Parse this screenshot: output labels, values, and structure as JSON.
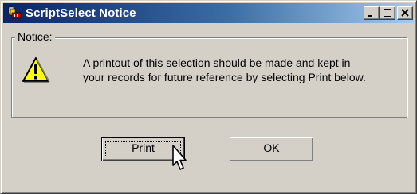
{
  "window": {
    "title": "ScriptSelect Notice"
  },
  "titlebar_buttons": {
    "minimize": "minimize-icon",
    "maximize": "maximize-icon",
    "close": "close-icon"
  },
  "notice": {
    "legend": "Notice:",
    "icon": "warning-icon",
    "message_lines": [
      "A printout of this selection should be made and kept in",
      "your records for future reference by selecting Print below."
    ]
  },
  "buttons": {
    "print_label": "Print",
    "ok_label": "OK"
  },
  "colors": {
    "titlebar_start": "#0a246a",
    "titlebar_end": "#a6caf0",
    "face": "#d4d0c8",
    "warning_yellow": "#ffff00"
  }
}
